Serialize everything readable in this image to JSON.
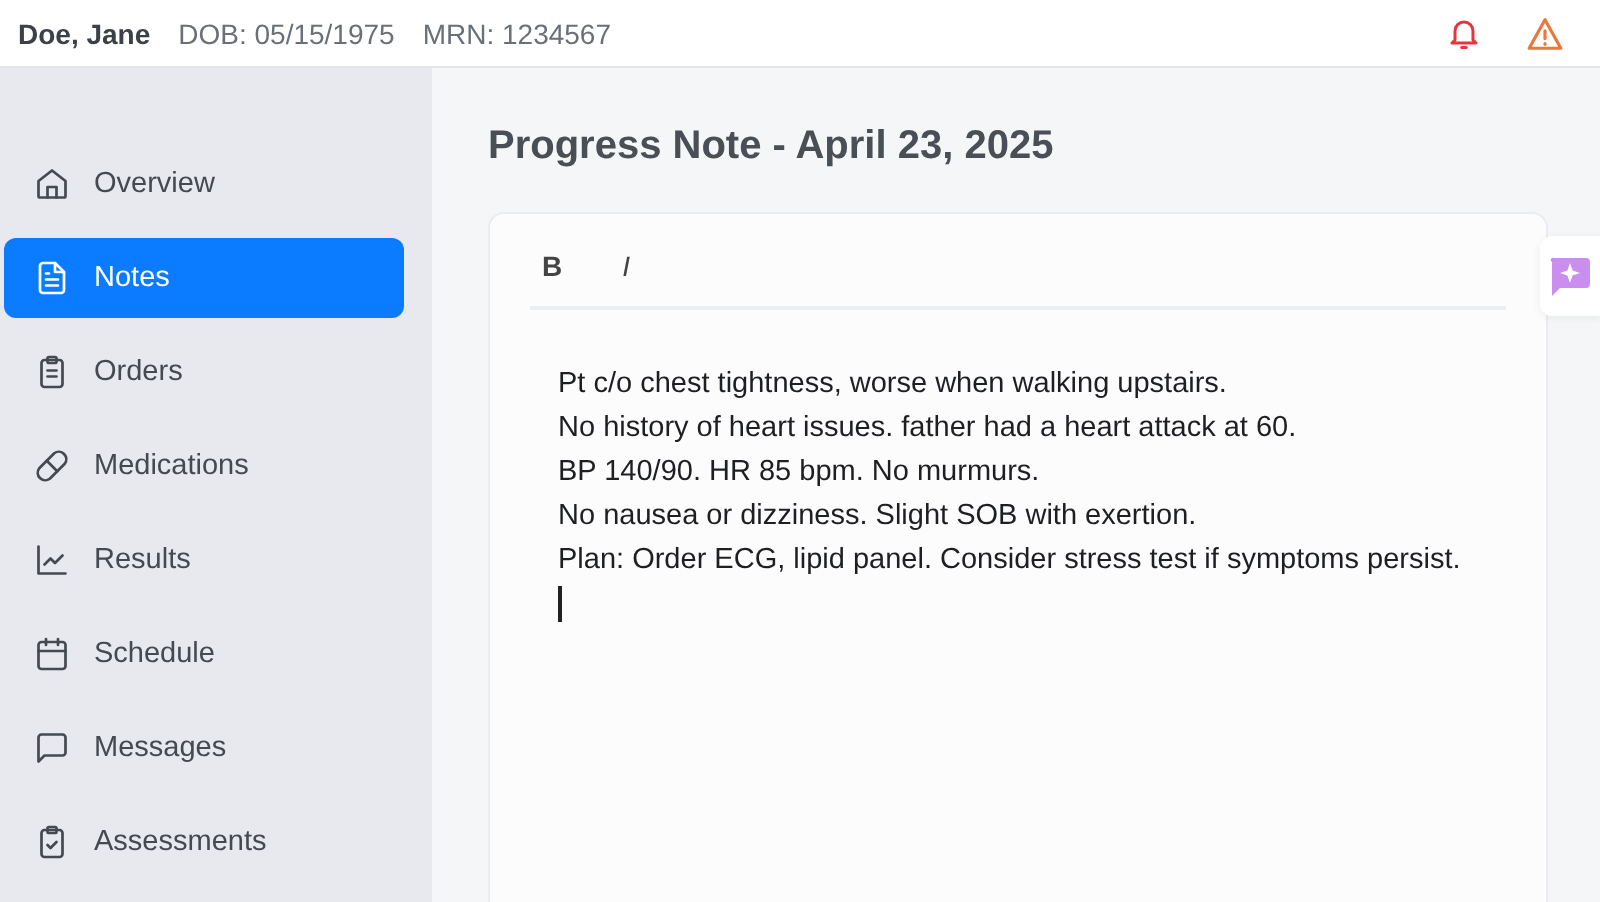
{
  "patient": {
    "name": "Doe, Jane",
    "dob": "DOB: 05/15/1975",
    "mrn": "MRN: 1234567"
  },
  "sidebar": {
    "items": [
      {
        "label": "Overview",
        "selected": false
      },
      {
        "label": "Notes",
        "selected": true
      },
      {
        "label": "Orders",
        "selected": false
      },
      {
        "label": "Medications",
        "selected": false
      },
      {
        "label": "Results",
        "selected": false
      },
      {
        "label": "Schedule",
        "selected": false
      },
      {
        "label": "Messages",
        "selected": false
      },
      {
        "label": "Assessments",
        "selected": false
      }
    ]
  },
  "page_title": "Progress Note - April 23, 2025",
  "toolbar": [
    "B",
    "I"
  ],
  "note_lines": [
    "Pt c/o chest tightness, worse when walking upstairs.",
    "No history of heart issues. father had a heart attack at 60.",
    "BP 140/90. HR 85 bpm. No murmurs.",
    "No nausea or dizziness. Slight SOB with exertion.",
    "Plan: Order ECG, lipid panel. Consider stress test if symptoms persist."
  ]
}
